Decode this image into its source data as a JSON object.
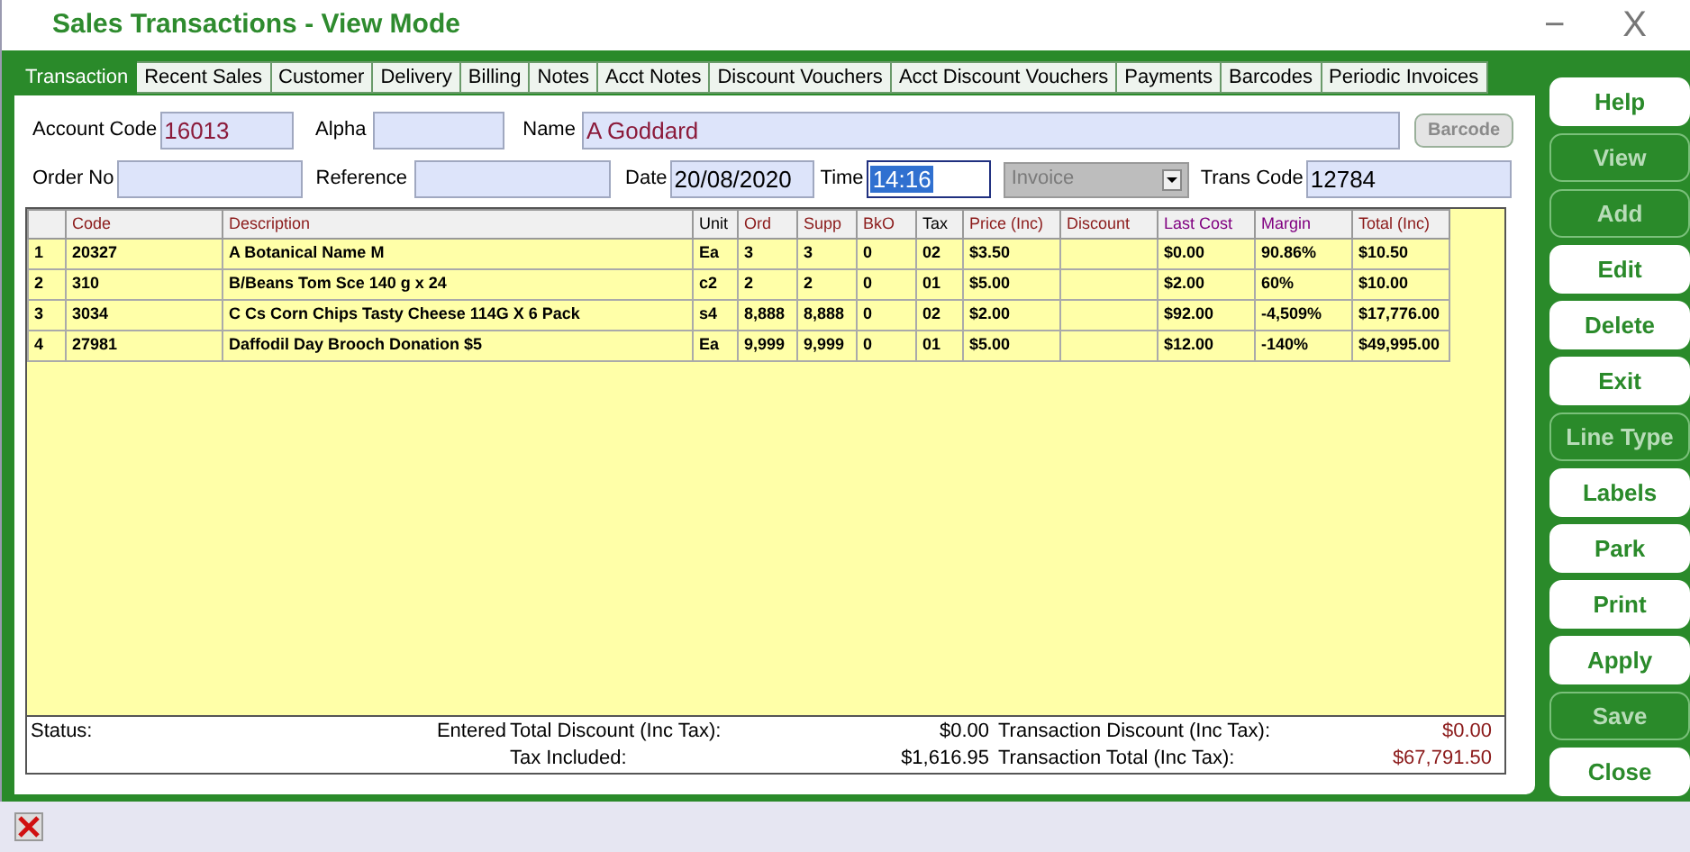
{
  "window": {
    "title": "Sales Transactions - View Mode",
    "controls": [
      "−",
      "X"
    ]
  },
  "tabs": [
    {
      "label": "Transaction",
      "selected": true
    },
    {
      "label": "Recent Sales",
      "selected": false
    },
    {
      "label": "Customer",
      "selected": false
    },
    {
      "label": "Delivery",
      "selected": false
    },
    {
      "label": "Billing",
      "selected": false
    },
    {
      "label": "Notes",
      "selected": false
    },
    {
      "label": "Acct Notes",
      "selected": false
    },
    {
      "label": "Discount Vouchers",
      "selected": false
    },
    {
      "label": "Acct Discount Vouchers",
      "selected": false
    },
    {
      "label": "Payments",
      "selected": false
    },
    {
      "label": "Barcodes",
      "selected": false
    },
    {
      "label": "Periodic Invoices",
      "selected": false
    }
  ],
  "header_fields": {
    "account_code": {
      "label": "Account Code",
      "value": "16013"
    },
    "alpha": {
      "label": "Alpha"
    },
    "name": {
      "label": "Name",
      "value": "A Goddard"
    },
    "barcode_button": {
      "label": "Barcode",
      "disabled": true
    },
    "order_no": {
      "label": "Order No"
    },
    "reference": {
      "label": "Reference"
    },
    "date": {
      "label": "Date",
      "value": "20/08/2020"
    },
    "time": {
      "label": "Time",
      "value": "14:16",
      "selected": true
    },
    "type_dropdown": {
      "value": "Invoice",
      "disabled": true
    },
    "trans_code": {
      "label": "Trans Code",
      "value": "12784"
    }
  },
  "table": {
    "columns": [
      {},
      {
        "label": "Code",
        "color": "#8b1a1a"
      },
      {
        "label": "Description",
        "color": "#8b1a1a"
      },
      {
        "label": "Unit",
        "color": "#000000"
      },
      {
        "label": "Ord",
        "color": "#8b1a1a"
      },
      {
        "label": "Supp",
        "color": "#8b1a1a"
      },
      {
        "label": "BkO",
        "color": "#8b1a1a"
      },
      {
        "label": "Tax",
        "color": "#000000"
      },
      {
        "label": "Price (Inc)",
        "color": "#8b1a1a"
      },
      {
        "label": "Discount",
        "color": "#8b1a1a"
      },
      {
        "label": "Last Cost",
        "color": "#800080"
      },
      {
        "label": "Margin",
        "color": "#800080"
      },
      {
        "label": "Total (Inc)",
        "color": "#8b1a1a"
      }
    ],
    "rows": [
      [
        "1",
        "20327",
        "A Botanical Name M",
        "Ea",
        "3",
        "3",
        "0",
        "02",
        "$3.50",
        "",
        "$0.00",
        "90.86%",
        "$10.50"
      ],
      [
        "2",
        "310",
        "B/Beans Tom Sce  140 g x 24",
        "c2",
        "2",
        "2",
        "0",
        "01",
        "$5.00",
        "",
        "$2.00",
        "60%",
        "$10.00"
      ],
      [
        "3",
        "3034",
        "C Cs Corn Chips Tasty Cheese 114G X 6 Pack",
        "s4",
        "8,888",
        "8,888",
        "0",
        "02",
        "$2.00",
        "",
        "$92.00",
        "-4,509%",
        "$17,776.00"
      ],
      [
        "4",
        "27981",
        "Daffodil Day Brooch Donation $5",
        "Ea",
        "9,999",
        "9,999",
        "0",
        "01",
        "$5.00",
        "",
        "$12.00",
        "-140%",
        "$49,995.00"
      ]
    ]
  },
  "totals": {
    "status_label": "Status:",
    "status_value": "Entered",
    "total_discount_label": "Total Discount (Inc Tax):",
    "total_discount": "$0.00",
    "transaction_discount_label": "Transaction Discount (Inc Tax):",
    "transaction_discount": "$0.00",
    "tax_included_label": "Tax Included:",
    "tax_included": "$1,616.95",
    "transaction_total_label": "Transaction Total (Inc Tax):",
    "transaction_total": "$67,791.50"
  },
  "side_buttons": [
    {
      "label": "Help",
      "disabled": false
    },
    {
      "label": "View",
      "disabled": true
    },
    {
      "label": "Add",
      "disabled": true
    },
    {
      "label": "Edit",
      "disabled": false
    },
    {
      "label": "Delete",
      "disabled": false
    },
    {
      "label": "Exit",
      "disabled": false
    },
    {
      "label": "Line Type",
      "disabled": true
    },
    {
      "label": "Labels",
      "disabled": false
    },
    {
      "label": "Park",
      "disabled": false
    },
    {
      "label": "Print",
      "disabled": false
    },
    {
      "label": "Apply",
      "disabled": false
    },
    {
      "label": "Save",
      "disabled": true
    },
    {
      "label": "Close",
      "disabled": false
    }
  ]
}
